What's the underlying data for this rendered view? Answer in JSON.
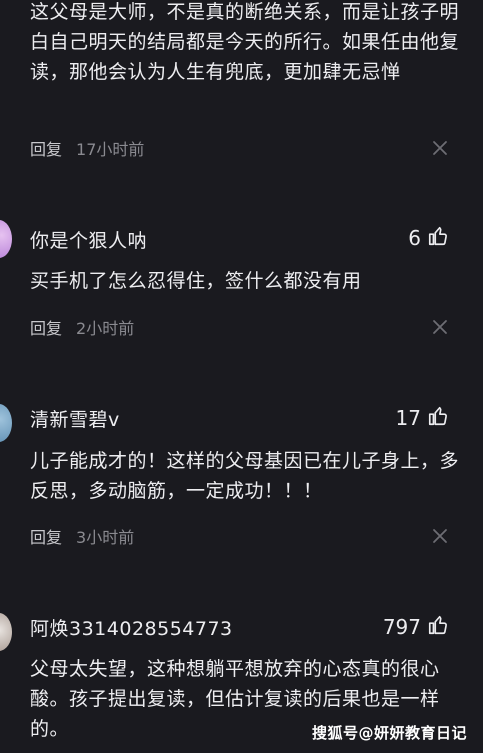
{
  "comments": [
    {
      "text": "这父母是大师，不是真的断绝关系，而是让孩子明白自己明天的结局都是今天的所行。如果任由他复读，那他会认为人生有兜底，更加肆无忌惮",
      "reply_label": "回复",
      "time": "17小时前"
    },
    {
      "username": "你是个狠人呐",
      "likes": "6",
      "text": "买手机了怎么忍得住，签什么都没有用",
      "reply_label": "回复",
      "time": "2小时前"
    },
    {
      "username": "清新雪碧v",
      "likes": "17",
      "text": "儿子能成才的！这样的父母基因已在儿子身上，多反思，多动脑筋，一定成功！！！",
      "reply_label": "回复",
      "time": "3小时前"
    },
    {
      "username": "阿焕3314028554773",
      "likes": "797",
      "text": "父母太失望，这种想躺平想放弃的心态真的很心酸。孩子提出复读，但估计复读的后果也是一样的。"
    }
  ],
  "watermark": "搜狐号@妍妍教育日记",
  "icons": {
    "like": "thumbs-up-icon",
    "close": "close-icon"
  },
  "colors": {
    "background": "#1a1a1f",
    "text": "#ededf0",
    "muted": "#8a8a90"
  }
}
